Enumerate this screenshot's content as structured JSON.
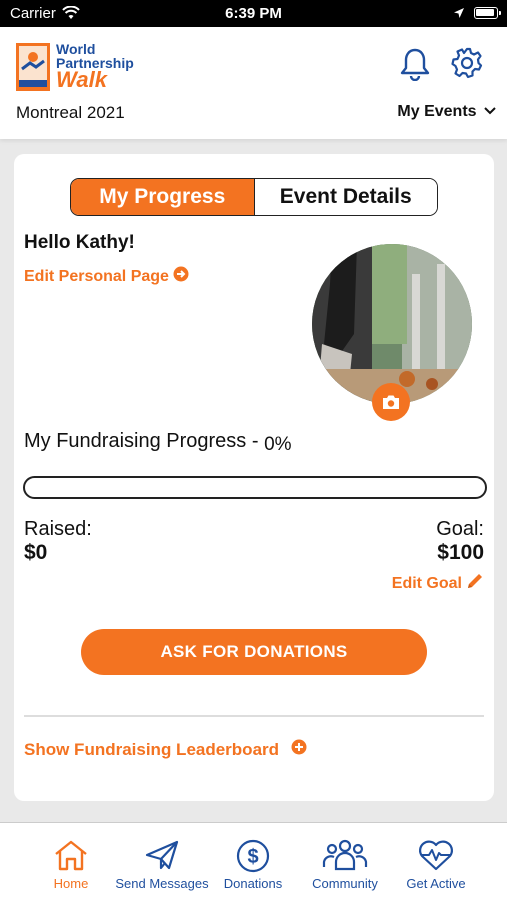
{
  "status_bar": {
    "carrier": "Carrier",
    "time": "6:39 PM"
  },
  "header": {
    "logo_line1": "World",
    "logo_line2": "Partnership",
    "logo_line3": "Walk",
    "event_name": "Montreal 2021",
    "my_events": "My Events"
  },
  "tabs_segment": {
    "active": "My Progress",
    "inactive": "Event Details"
  },
  "profile": {
    "greeting": "Hello Kathy!",
    "edit_page": "Edit Personal Page"
  },
  "progress": {
    "title": "My Fundraising Progress - ",
    "percent_label": "0%",
    "fraction": 0,
    "raised_label": "Raised:",
    "raised_value": "$0",
    "goal_label": "Goal:",
    "goal_value": "$100",
    "edit_goal": "Edit Goal"
  },
  "ask_button": "ASK FOR DONATIONS",
  "leaderboard": "Show Fundraising Leaderboard",
  "bottom_nav": [
    {
      "label": "Home",
      "icon": "home-icon"
    },
    {
      "label": "Send Messages",
      "icon": "paper-plane-icon"
    },
    {
      "label": "Donations",
      "icon": "dollar-circle-icon"
    },
    {
      "label": "Community",
      "icon": "users-icon"
    },
    {
      "label": "Get Active",
      "icon": "heartbeat-icon"
    }
  ],
  "colors": {
    "accent": "#f37321",
    "brand_blue": "#1f4f9e"
  }
}
